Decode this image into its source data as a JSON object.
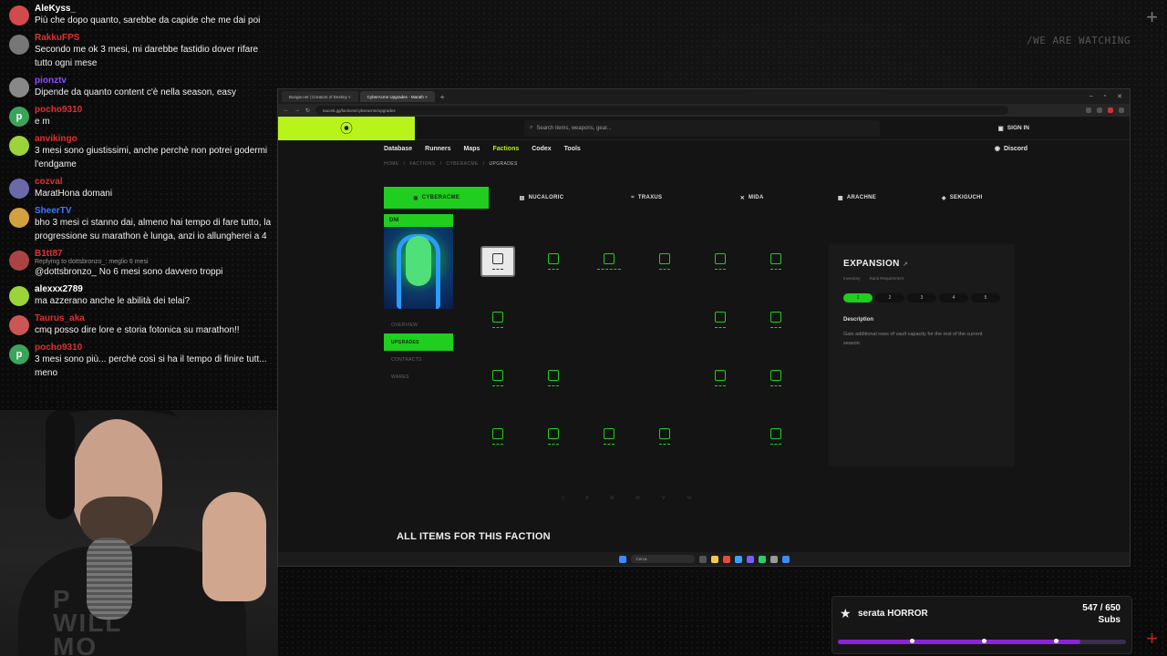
{
  "overlay": {
    "watermark": "/WE ARE WATCHING",
    "subgoal": {
      "title": "serata HORROR",
      "current": "547 / 650",
      "unit": "Subs",
      "progress": 0.8415
    }
  },
  "chat": [
    {
      "user": "AleKyss_",
      "color": "#ffffff",
      "avatar": "#d24a4a",
      "text": "Più che dopo quanto, sarebbe da capide che me dai poi"
    },
    {
      "user": "RakkuFPS",
      "color": "#e03030",
      "avatar": "#777777",
      "text": "Secondo me ok 3 mesi, mi darebbe fastidio dover rifare tutto ogni mese"
    },
    {
      "user": "pionztv",
      "color": "#8a4bff",
      "avatar": "#888888",
      "text": "Dipende da quanto content c'è nella season, easy"
    },
    {
      "user": "pocho9310",
      "color": "#e03030",
      "avatar": "#3aa55a",
      "avatar_letter": "p",
      "text": "e m"
    },
    {
      "user": "anvikingo",
      "color": "#e03030",
      "avatar": "#9bd33a",
      "text": "3 mesi sono giustissimi, anche perchè non potrei godermi l'endgame"
    },
    {
      "user": "cozval",
      "color": "#e03030",
      "avatar": "#6a6aaa",
      "text": "MaratHona domani"
    },
    {
      "user": "SheerTV",
      "color": "#3a7bff",
      "avatar": "#d2a040",
      "text": "bho 3 mesi ci stanno dai, almeno hai tempo di fare tutto, la progressione su marathon è lunga, anzi io allungherei a 4"
    },
    {
      "user": "B1tt87",
      "color": "#e03030",
      "avatar": "#aa4444",
      "reply": "Replying to dottsbronzo_: meglio 6 mesi",
      "text": "@dottsbronzo_ No 6 mesi sono davvero troppi"
    },
    {
      "user": "alexxx2789",
      "color": "#ffffff",
      "avatar": "#9bd33a",
      "text": "ma azzerano anche le abilità dei telai?"
    },
    {
      "user": "Taurus_aka",
      "color": "#e03030",
      "avatar": "#cc5555",
      "text": "cmq posso dire lore e storia fotonica su marathon!!"
    },
    {
      "user": "pocho9310",
      "color": "#e03030",
      "avatar": "#3aa55a",
      "avatar_letter": "p",
      "text": "3 mesi sono più... perchè così si ha il tempo di finire tutt... meno"
    }
  ],
  "browser": {
    "tabs": [
      "Bungie.net | Creators of Destiny",
      "CyberAcme Upgrades - Marath"
    ],
    "url": "tauceti.gg/factions/cyberacme/upgrades",
    "search_placeholder": "Search items, weapons, gear...",
    "sign_in": "SIGN IN",
    "nav": [
      "Database",
      "Runners",
      "Maps",
      "Factions",
      "Codex",
      "Tools"
    ],
    "nav_active": "Factions",
    "discord": "Discord",
    "breadcrumb": [
      "HOME",
      "FACTIONS",
      "CYBERACME",
      "UPGRADES"
    ],
    "factions": [
      "CYBERACME",
      "NUCALORIC",
      "TRAXUS",
      "MIDA",
      "ARACHNE",
      "SEKIGUCHI"
    ],
    "faction_active": "CYBERACME",
    "card_label": "DNI",
    "side_menu": [
      "OVERVIEW",
      "UPGRADES",
      "CONTRACTS",
      "WARES"
    ],
    "side_active": "UPGRADES",
    "pager": [
      "I",
      "II",
      "III",
      "IV",
      "V",
      "VI"
    ],
    "detail": {
      "title": "EXPANSION",
      "meta": [
        "Inventory",
        "Rank Requirement"
      ],
      "ranks": [
        "1",
        "2",
        "3",
        "4",
        "5"
      ],
      "rank_active": "1",
      "desc_label": "Description",
      "desc": "Gain additional rows of vault capacity for the rest of the current season."
    },
    "all_items": "ALL ITEMS FOR THIS FACTION",
    "taskbar_search": "Cerca"
  }
}
